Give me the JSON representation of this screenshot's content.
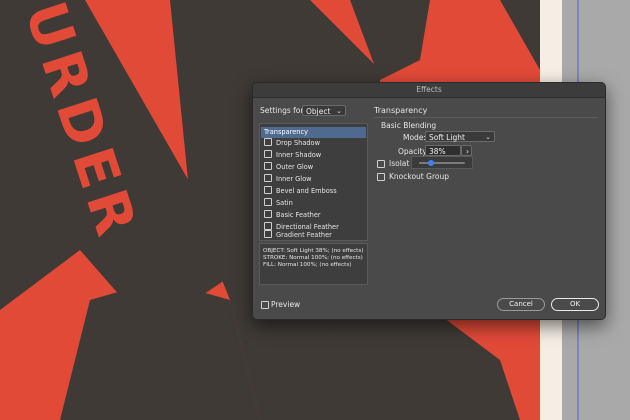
{
  "canvas": {
    "poster_text": "URDER"
  },
  "dialog": {
    "title": "Effects",
    "settings_for_label": "Settings for:",
    "settings_for_value": "Object",
    "effects_list": [
      {
        "label": "Transparency",
        "active": true,
        "checkbox": false
      },
      {
        "label": "Drop Shadow",
        "active": false,
        "checkbox": true
      },
      {
        "label": "Inner Shadow",
        "active": false,
        "checkbox": true
      },
      {
        "label": "Outer Glow",
        "active": false,
        "checkbox": true
      },
      {
        "label": "Inner Glow",
        "active": false,
        "checkbox": true
      },
      {
        "label": "Bevel and Emboss",
        "active": false,
        "checkbox": true
      },
      {
        "label": "Satin",
        "active": false,
        "checkbox": true
      },
      {
        "label": "Basic Feather",
        "active": false,
        "checkbox": true
      },
      {
        "label": "Directional Feather",
        "active": false,
        "checkbox": true
      },
      {
        "label": "Gradient Feather",
        "active": false,
        "checkbox": true
      }
    ],
    "summary": {
      "object": "OBJECT: Soft Light 38%; (no effects)",
      "stroke": "STROKE: Normal 100%; (no effects)",
      "fill": "FILL: Normal 100%; (no effects)"
    },
    "panel": {
      "section_title": "Transparency",
      "group_title": "Basic Blending",
      "mode_label": "Mode:",
      "mode_value": "Soft Light",
      "opacity_label": "Opacity:",
      "opacity_value": "38%",
      "opacity_fraction": 0.38,
      "isolate_label": "Isolat",
      "knockout_label": "Knockout Group"
    },
    "preview_label": "Preview",
    "cancel_label": "Cancel",
    "ok_label": "OK"
  },
  "colors": {
    "poster_red": "#e24a38",
    "poster_dark": "#3f3a35",
    "dialog_bg": "#4a4a4a",
    "selection_blue": "#4f6a8f",
    "slider_blue": "#3b82f6"
  }
}
